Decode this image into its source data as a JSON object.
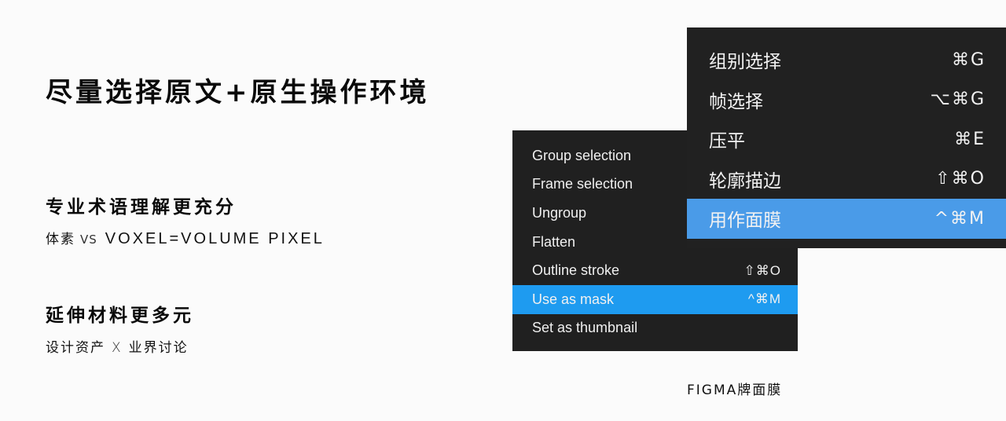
{
  "slide": {
    "title": "尽量选择原文+原生操作环境",
    "points": [
      {
        "heading": "专业术语理解更充分",
        "detail_left": "体素",
        "detail_sep": "VS",
        "detail_right": "VOXEL=VOLUME PIXEL"
      },
      {
        "heading": "延伸材料更多元",
        "detail_left": "设计资产",
        "detail_sep": "X",
        "detail_right": "业界讨论"
      }
    ],
    "caption": "FIGMA牌面膜"
  },
  "menu_en": {
    "items": [
      {
        "label": "Group selection",
        "shortcut": ""
      },
      {
        "label": "Frame selection",
        "shortcut": ""
      },
      {
        "label": "Ungroup",
        "shortcut": ""
      },
      {
        "label": "Flatten",
        "shortcut": ""
      },
      {
        "label": "Outline stroke",
        "shortcut": "⇧⌘O"
      },
      {
        "label": "Use as mask",
        "shortcut": "^⌘M",
        "active": true
      },
      {
        "label": "Set as thumbnail",
        "shortcut": ""
      }
    ],
    "highlight_color": "#1e9bf0"
  },
  "menu_zh": {
    "items": [
      {
        "label": "组别选择",
        "shortcut": "⌘G"
      },
      {
        "label": "帧选择",
        "shortcut": "⌥⌘G"
      },
      {
        "label": "压平",
        "shortcut": "⌘E"
      },
      {
        "label": "轮廓描边",
        "shortcut": "⇧⌘O"
      },
      {
        "label": "用作面膜",
        "shortcut": "^⌘M",
        "active": true
      }
    ],
    "highlight_color": "#4a9be8"
  }
}
